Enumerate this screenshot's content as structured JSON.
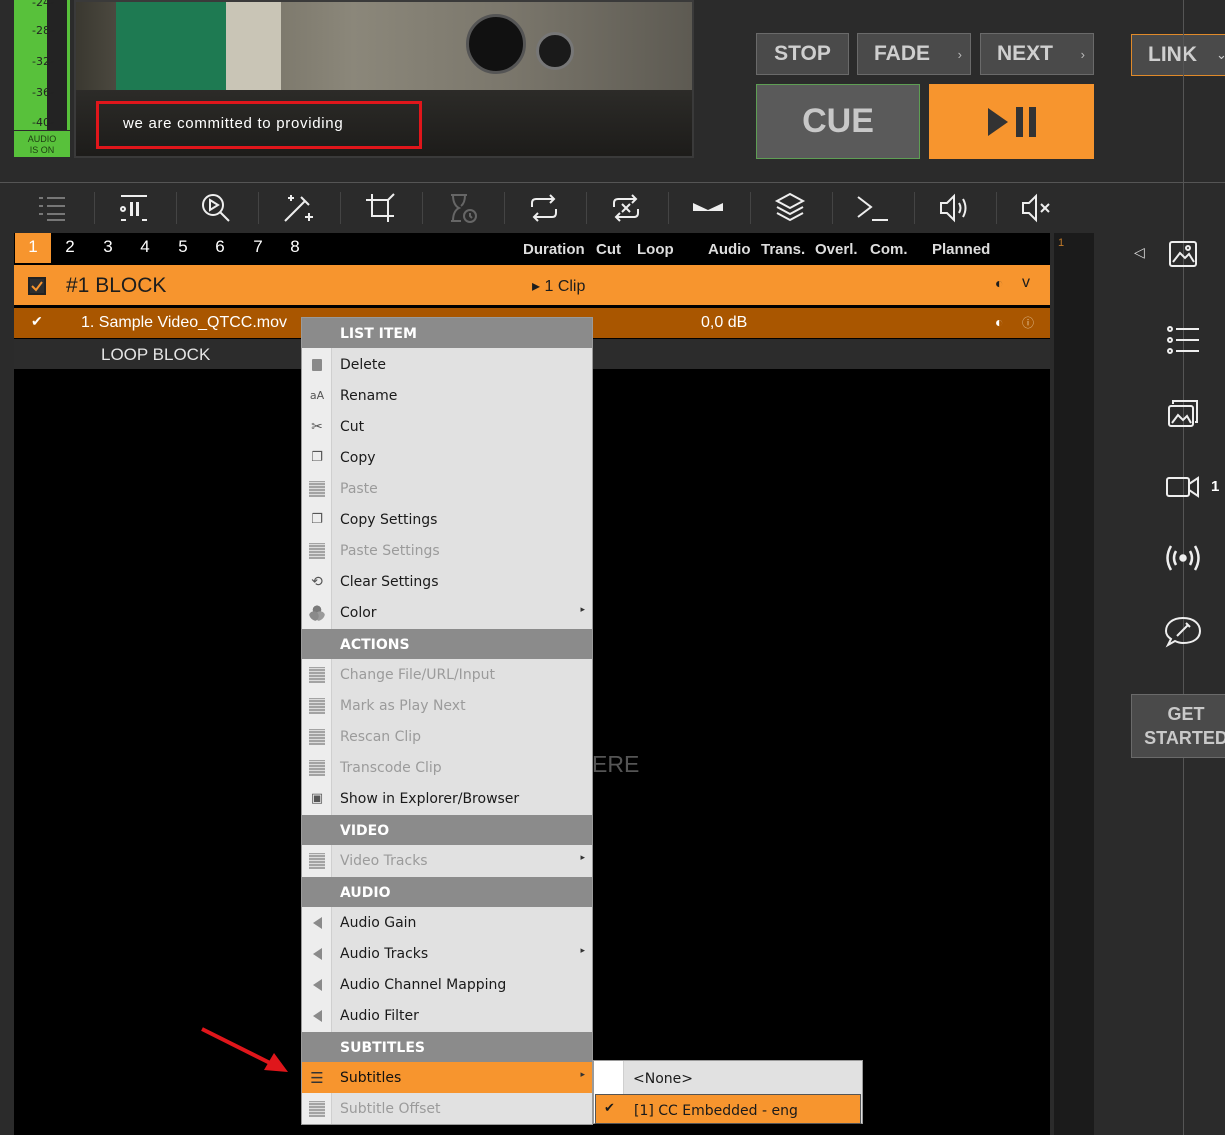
{
  "meter": {
    "ticks": [
      "-24-",
      "-28-",
      "-32-",
      "-36-",
      "-40-"
    ],
    "status_line1": "AUDIO",
    "status_line2": "IS ON"
  },
  "preview": {
    "caption": "we are committed to providing"
  },
  "transport": {
    "stop": "STOP",
    "fade": "FADE",
    "next": "NEXT",
    "link": "LINK",
    "cue": "CUE",
    "play_pause_icon": "play-pause-icon"
  },
  "toolbar_icons": [
    "list-settings-icon",
    "pause-block-icon",
    "search-play-icon",
    "magic-wand-icon",
    "crop-icon",
    "timer-icon",
    "loop-icon",
    "shuffle-icon",
    "transition-icon",
    "layers-icon",
    "command-icon",
    "volume-icon",
    "mute-icon"
  ],
  "playlist": {
    "tabs": [
      "1",
      "2",
      "3",
      "4",
      "5",
      "6",
      "7",
      "8"
    ],
    "active_tab": "1",
    "columns": {
      "duration": "Duration",
      "cut": "Cut",
      "loop": "Loop",
      "audio": "Audio",
      "trans": "Trans.",
      "overl": "Overl.",
      "com": "Com.",
      "planned": "Planned"
    },
    "block": {
      "title": "#1  BLOCK",
      "clips": "▸ 1 Clip",
      "toggle": "v"
    },
    "clip": {
      "name": "1. Sample Video_QTCC.mov",
      "audio": "0,0 dB"
    },
    "loop_label": "LOOP BLOCK",
    "background_hint": "ERE",
    "ruler_number": "1"
  },
  "sidebar": {
    "camera_count": "1",
    "get_started_line1": "GET",
    "get_started_line2": "STARTED"
  },
  "context_menu": {
    "list_item_header": "LIST ITEM",
    "delete": "Delete",
    "rename": "Rename",
    "cut": "Cut",
    "copy": "Copy",
    "paste": "Paste",
    "copy_settings": "Copy Settings",
    "paste_settings": "Paste Settings",
    "clear_settings": "Clear Settings",
    "color": "Color",
    "actions_header": "ACTIONS",
    "change_file": "Change File/URL/Input",
    "mark_play_next": "Mark as Play Next",
    "rescan_clip": "Rescan Clip",
    "transcode_clip": "Transcode Clip",
    "show_in_explorer": "Show in Explorer/Browser",
    "video_header": "VIDEO",
    "video_tracks": "Video Tracks",
    "audio_header": "AUDIO",
    "audio_gain": "Audio Gain",
    "audio_tracks": "Audio Tracks",
    "audio_channel_mapping": "Audio Channel Mapping",
    "audio_filter": "Audio Filter",
    "subtitles_header": "SUBTITLES",
    "subtitles": "Subtitles",
    "subtitle_offset": "Subtitle Offset",
    "rename_glyph": "aA"
  },
  "subtitles_submenu": {
    "none": "<None>",
    "cc_embedded": "[1] CC Embedded - eng",
    "selected": "[1] CC Embedded - eng"
  },
  "colors": {
    "accent": "#f7952e",
    "meter_green": "#58c13b",
    "annotation_red": "#e0161b",
    "clip_row": "#a95600"
  }
}
